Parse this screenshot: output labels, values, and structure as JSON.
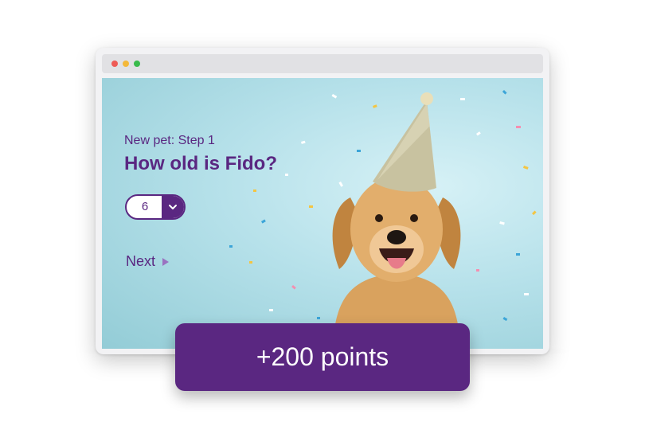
{
  "window": {
    "controls": [
      "close",
      "minimize",
      "maximize"
    ]
  },
  "form": {
    "step_label": "New pet: Step 1",
    "question": "How old is Fido?",
    "age_select": {
      "value": "6",
      "icon": "chevron-down-icon"
    },
    "next_label": "Next",
    "next_icon": "play-arrow-icon"
  },
  "photo": {
    "subject": "dog-with-party-hat",
    "icon": "dog-photo"
  },
  "reward": {
    "label": "+200 points"
  },
  "colors": {
    "accent": "#5a2781",
    "background": "#b6e1ea",
    "window_chrome": "#e1e1e4"
  }
}
